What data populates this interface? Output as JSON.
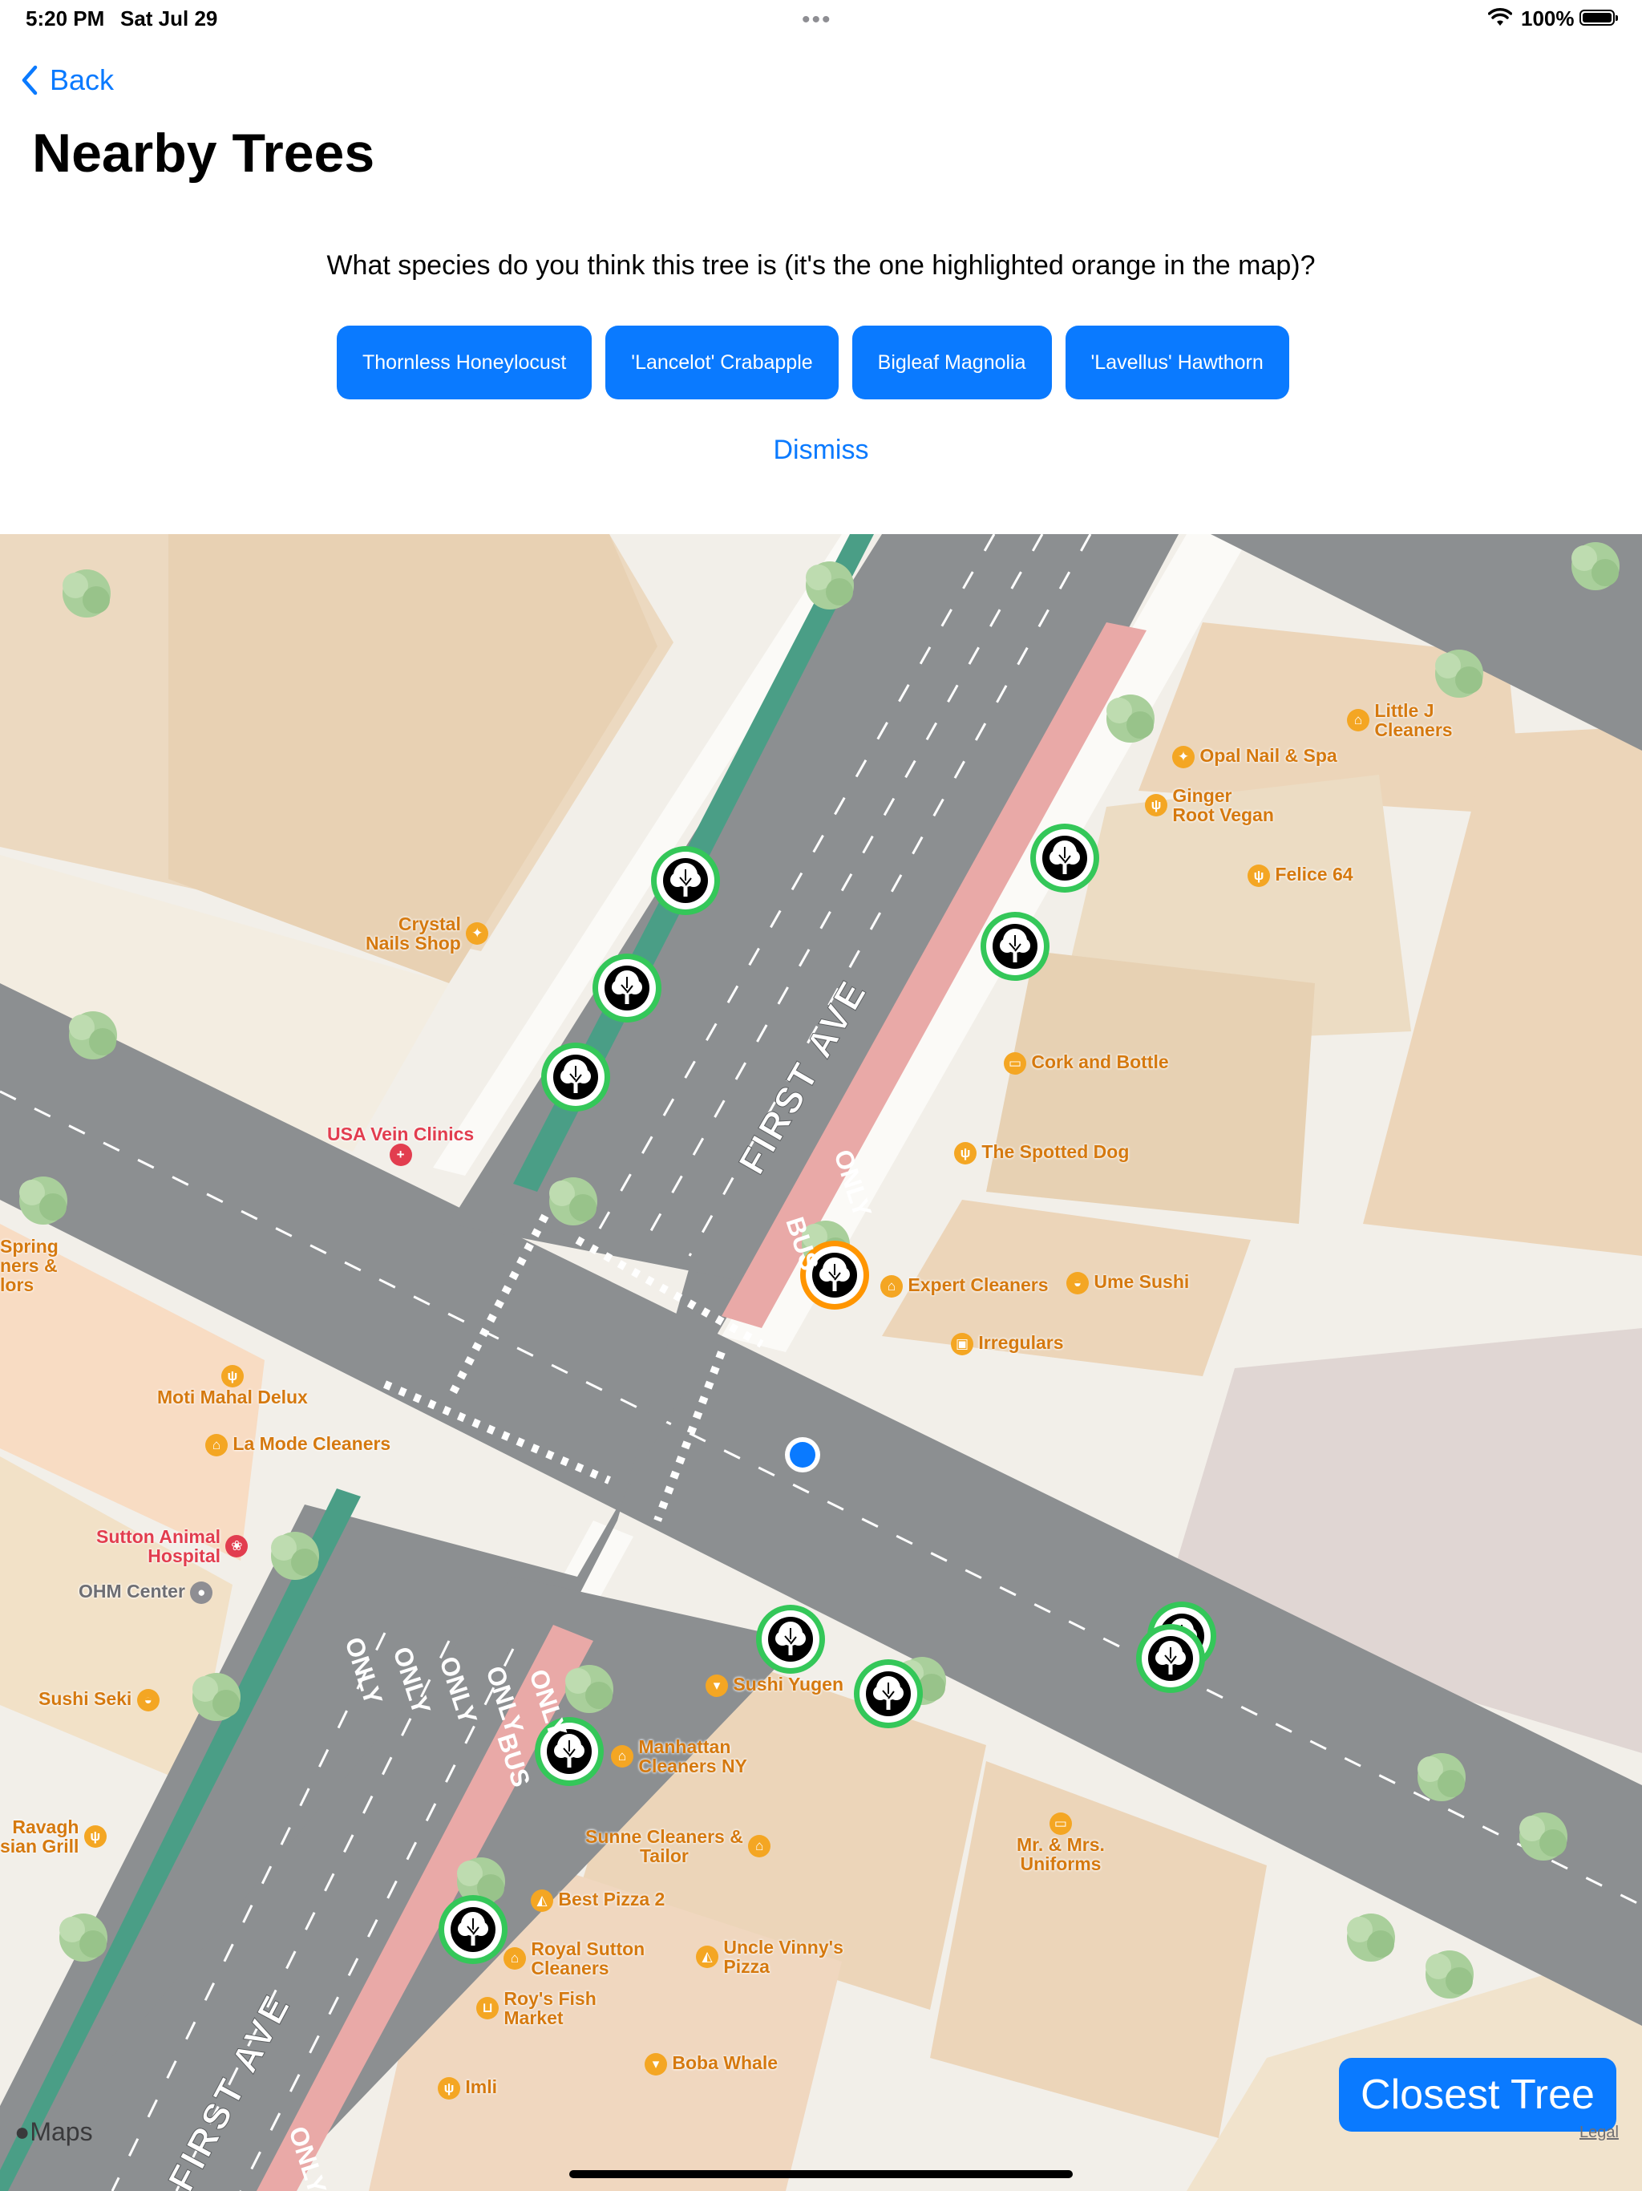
{
  "status_bar": {
    "time": "5:20 PM",
    "date": "Sat Jul 29",
    "battery": "100%"
  },
  "nav": {
    "back_label": "Back"
  },
  "title": "Nearby Trees",
  "question": "What species do you think this tree is (it's the one highlighted orange in the map)?",
  "answers": [
    "Thornless Honeylocust",
    "'Lancelot' Crabapple",
    "Bigleaf Magnolia",
    "'Lavellus' Hawthorn"
  ],
  "dismiss_label": "Dismiss",
  "map": {
    "street_labels": [
      "FIRST AVE",
      "FIRST AVE"
    ],
    "lane_labels": [
      "ONLY",
      "BUS",
      "ONLY",
      "ONLY",
      "ONLY",
      "ONLY",
      "ONLY",
      "BUS",
      "ONLY"
    ],
    "pois": [
      "Little J\nCleaners",
      "Opal Nail & Spa",
      "Ginger\nRoot Vegan",
      "Felice 64",
      "Crystal\nNails Shop",
      "Cork and Bottle",
      "The Spotted Dog",
      "USA Vein Clinics",
      "Expert Cleaners",
      "Ume Sushi",
      "Irregulars",
      "Spring\nners &\nlors",
      "Moti Mahal Delux",
      "La Mode Cleaners",
      "Sutton Animal\nHospital",
      "OHM Center",
      "Sushi Seki",
      "Sushi Yugen",
      "Manhattan\nCleaners NY",
      "Ravagh\nsian Grill",
      "Sunne Cleaners &\nTailor",
      "Mr. & Mrs.\nUniforms",
      "Best Pizza 2",
      "Royal Sutton\nCleaners",
      "Uncle Vinny's\nPizza",
      "Roy's Fish\nMarket",
      "Boba Whale",
      "Imli"
    ],
    "brand": "Maps",
    "legal": "Legal"
  },
  "closest_tree_label": "Closest Tree",
  "colors": {
    "accent": "#0a7aff",
    "tree_ring": "#34c759",
    "highlight_ring": "#ff9500",
    "bus_lane": "#e9a9a7",
    "bike_lane": "#4a9e86"
  }
}
